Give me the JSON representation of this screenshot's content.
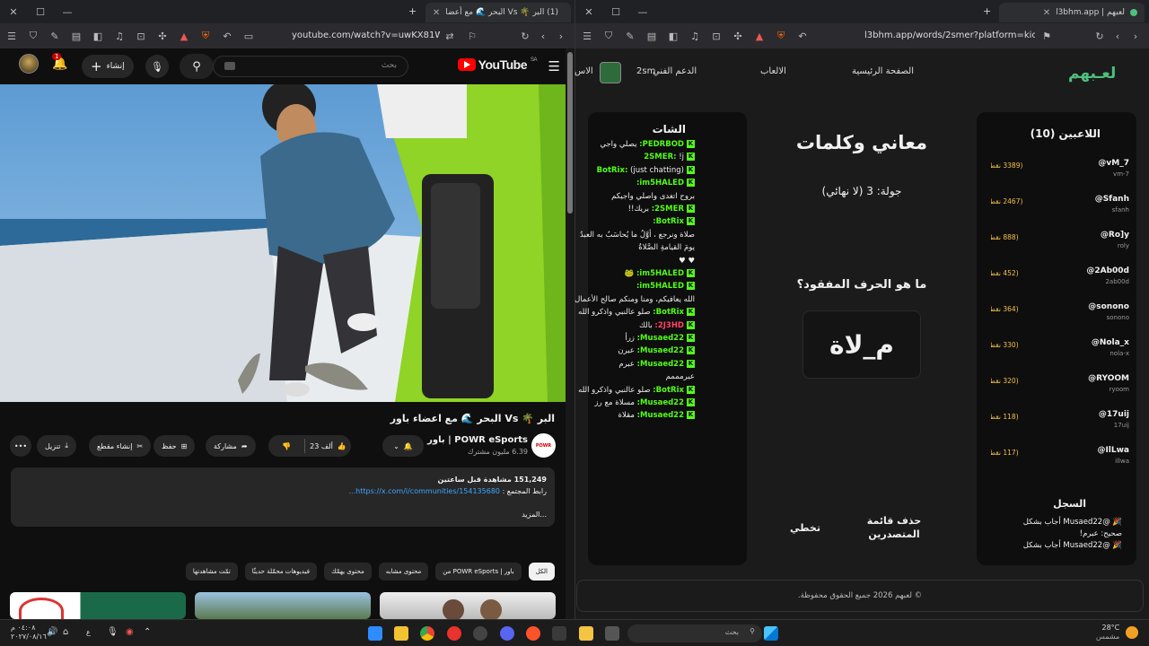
{
  "left_browser": {
    "tab_title": "(1) البر 🌴 Vs البحر 🌊 مع أعضا",
    "url": "youtube.com/watch?v=uwKX81WsQng",
    "notif_count": "1",
    "search_placeholder": "بحث",
    "create_label": "إنشاء",
    "logo_text": "YouTube",
    "logo_region": "SA",
    "video_title": "البر 🌴 Vs البحر 🌊 مع اعضاء باور",
    "channel_name": "POWR eSports | باور",
    "channel_subs": "6.39 مليون مشترك",
    "likes": "23 ألف",
    "share_label": "مشاركة",
    "save_label": "حفظ",
    "clip_label": "إنشاء مقطع",
    "download_label": "تنزيل",
    "desc_views": "151,249 مشاهدة قبل ساعتين",
    "desc_link_label": "رابط المجتمع :",
    "desc_link": "https://x.com/i/communities/154135680...",
    "desc_more": "...المزيد",
    "chips": [
      "الكل",
      "من POWR eSports | باور",
      "محتوى مشابه",
      "محتوى يهمّك",
      "فيديوهات محمّلة حديثًا",
      "تمّت مشاهدتها"
    ],
    "channel_logo_text": "POWR"
  },
  "right_browser": {
    "tab_title": "لعبهم | l3bhm.app",
    "url": "l3bhm.app/words/2smer?platform=kick",
    "logo": "لعـبهم",
    "nav": {
      "home": "الصفحة الرئيسية",
      "games": "الالعاب",
      "support": "الدعم الفني",
      "user": "2sm",
      "extra": "الاس"
    },
    "players_title": "اللاعبين (10)",
    "players": [
      {
        "name": "@vM_7",
        "handle": "vm-7",
        "points": "(3389 نقطة)"
      },
      {
        "name": "@Sfanh",
        "handle": "sfanh",
        "points": "(2467 نقطة)"
      },
      {
        "name": "@Ro]y",
        "handle": "roly",
        "points": "(888 نقطة)"
      },
      {
        "name": "@2Ab00d",
        "handle": "2ab00d",
        "points": "(452 نقطة)"
      },
      {
        "name": "@sonono",
        "handle": "sonono",
        "points": "(364 نقطة)"
      },
      {
        "name": "@Nola_x",
        "handle": "nola-x",
        "points": "(330 نقطة)"
      },
      {
        "name": "@RYOOM",
        "handle": "ryoom",
        "points": "(320 نقطة)"
      },
      {
        "name": "@17uij",
        "handle": "17uij",
        "points": "(118 نقطة)"
      },
      {
        "name": "@IlLwa",
        "handle": "illwa",
        "points": "(117 نقطة)"
      }
    ],
    "log_title": "السجل",
    "log": [
      "🎉 @Musaed22 أجاب بشكل",
      "صحيح: عبرم!",
      "🎉 @Musaed22 أجاب بشكل"
    ],
    "game_title": "معاني وكلمات",
    "round": "جولة: 3 (لا نهائي)",
    "question": "ما هو الحرف المفقود؟",
    "word": "م_لاة",
    "delete_btn": "حذف قائمة المتصدرين",
    "skip_btn": "تخطي",
    "chat_title": "الشات",
    "chat": [
      {
        "user": "PEDRBOD:",
        "text": "يصلي واجي"
      },
      {
        "user": "2SMER:",
        "text": "!j"
      },
      {
        "user": "BotRix:",
        "text": "(just chatting)"
      },
      {
        "user": "im5HALED:",
        "text": ""
      },
      {
        "user": "",
        "text": "بروح اتغدى واصلي واجيكم"
      },
      {
        "user": "2SMER:",
        "text": "بريك!!"
      },
      {
        "user": "BotRix:",
        "text": ""
      },
      {
        "user": "",
        "text": "صلاة ونرجع ، أوَّلُ ما يُحاسَبُ به العبدُ"
      },
      {
        "user": "",
        "text": "يومَ القيامةِ الصَّلاةُ"
      },
      {
        "user": "",
        "text": "♥ ♥"
      },
      {
        "user": "im5HALED:",
        "text": "🐸"
      },
      {
        "user": "im5HALED:",
        "text": ""
      },
      {
        "user": "",
        "text": "الله يعافيكم، ومنا ومنكم صالح الأعمال"
      },
      {
        "user": "BotRix:",
        "text": "صلو عالنبي واذكرو الله"
      },
      {
        "user": "2J3HD:",
        "text": "بالك",
        "red": true
      },
      {
        "user": "Musaed22:",
        "text": "زرأ"
      },
      {
        "user": "Musaed22:",
        "text": "عبرن"
      },
      {
        "user": "Musaed22:",
        "text": "عبرم"
      },
      {
        "user": "",
        "text": "عبرمممم"
      },
      {
        "user": "BotRix:",
        "text": "صلو عالنبي واذكرو الله"
      },
      {
        "user": "Musaed22:",
        "text": "مسلاة مع رز"
      },
      {
        "user": "Musaed22:",
        "text": "مقلاة"
      }
    ],
    "footer": "© لعبهم 2026 جميع الحقوق محفوظة."
  },
  "taskbar": {
    "search": "بحث",
    "weather_temp": "28°C",
    "weather_desc": "مشمس",
    "time": "٠٤:٠٨ م",
    "date": "٢٠٢٧/٠٨/١٦",
    "lang": "ع"
  }
}
